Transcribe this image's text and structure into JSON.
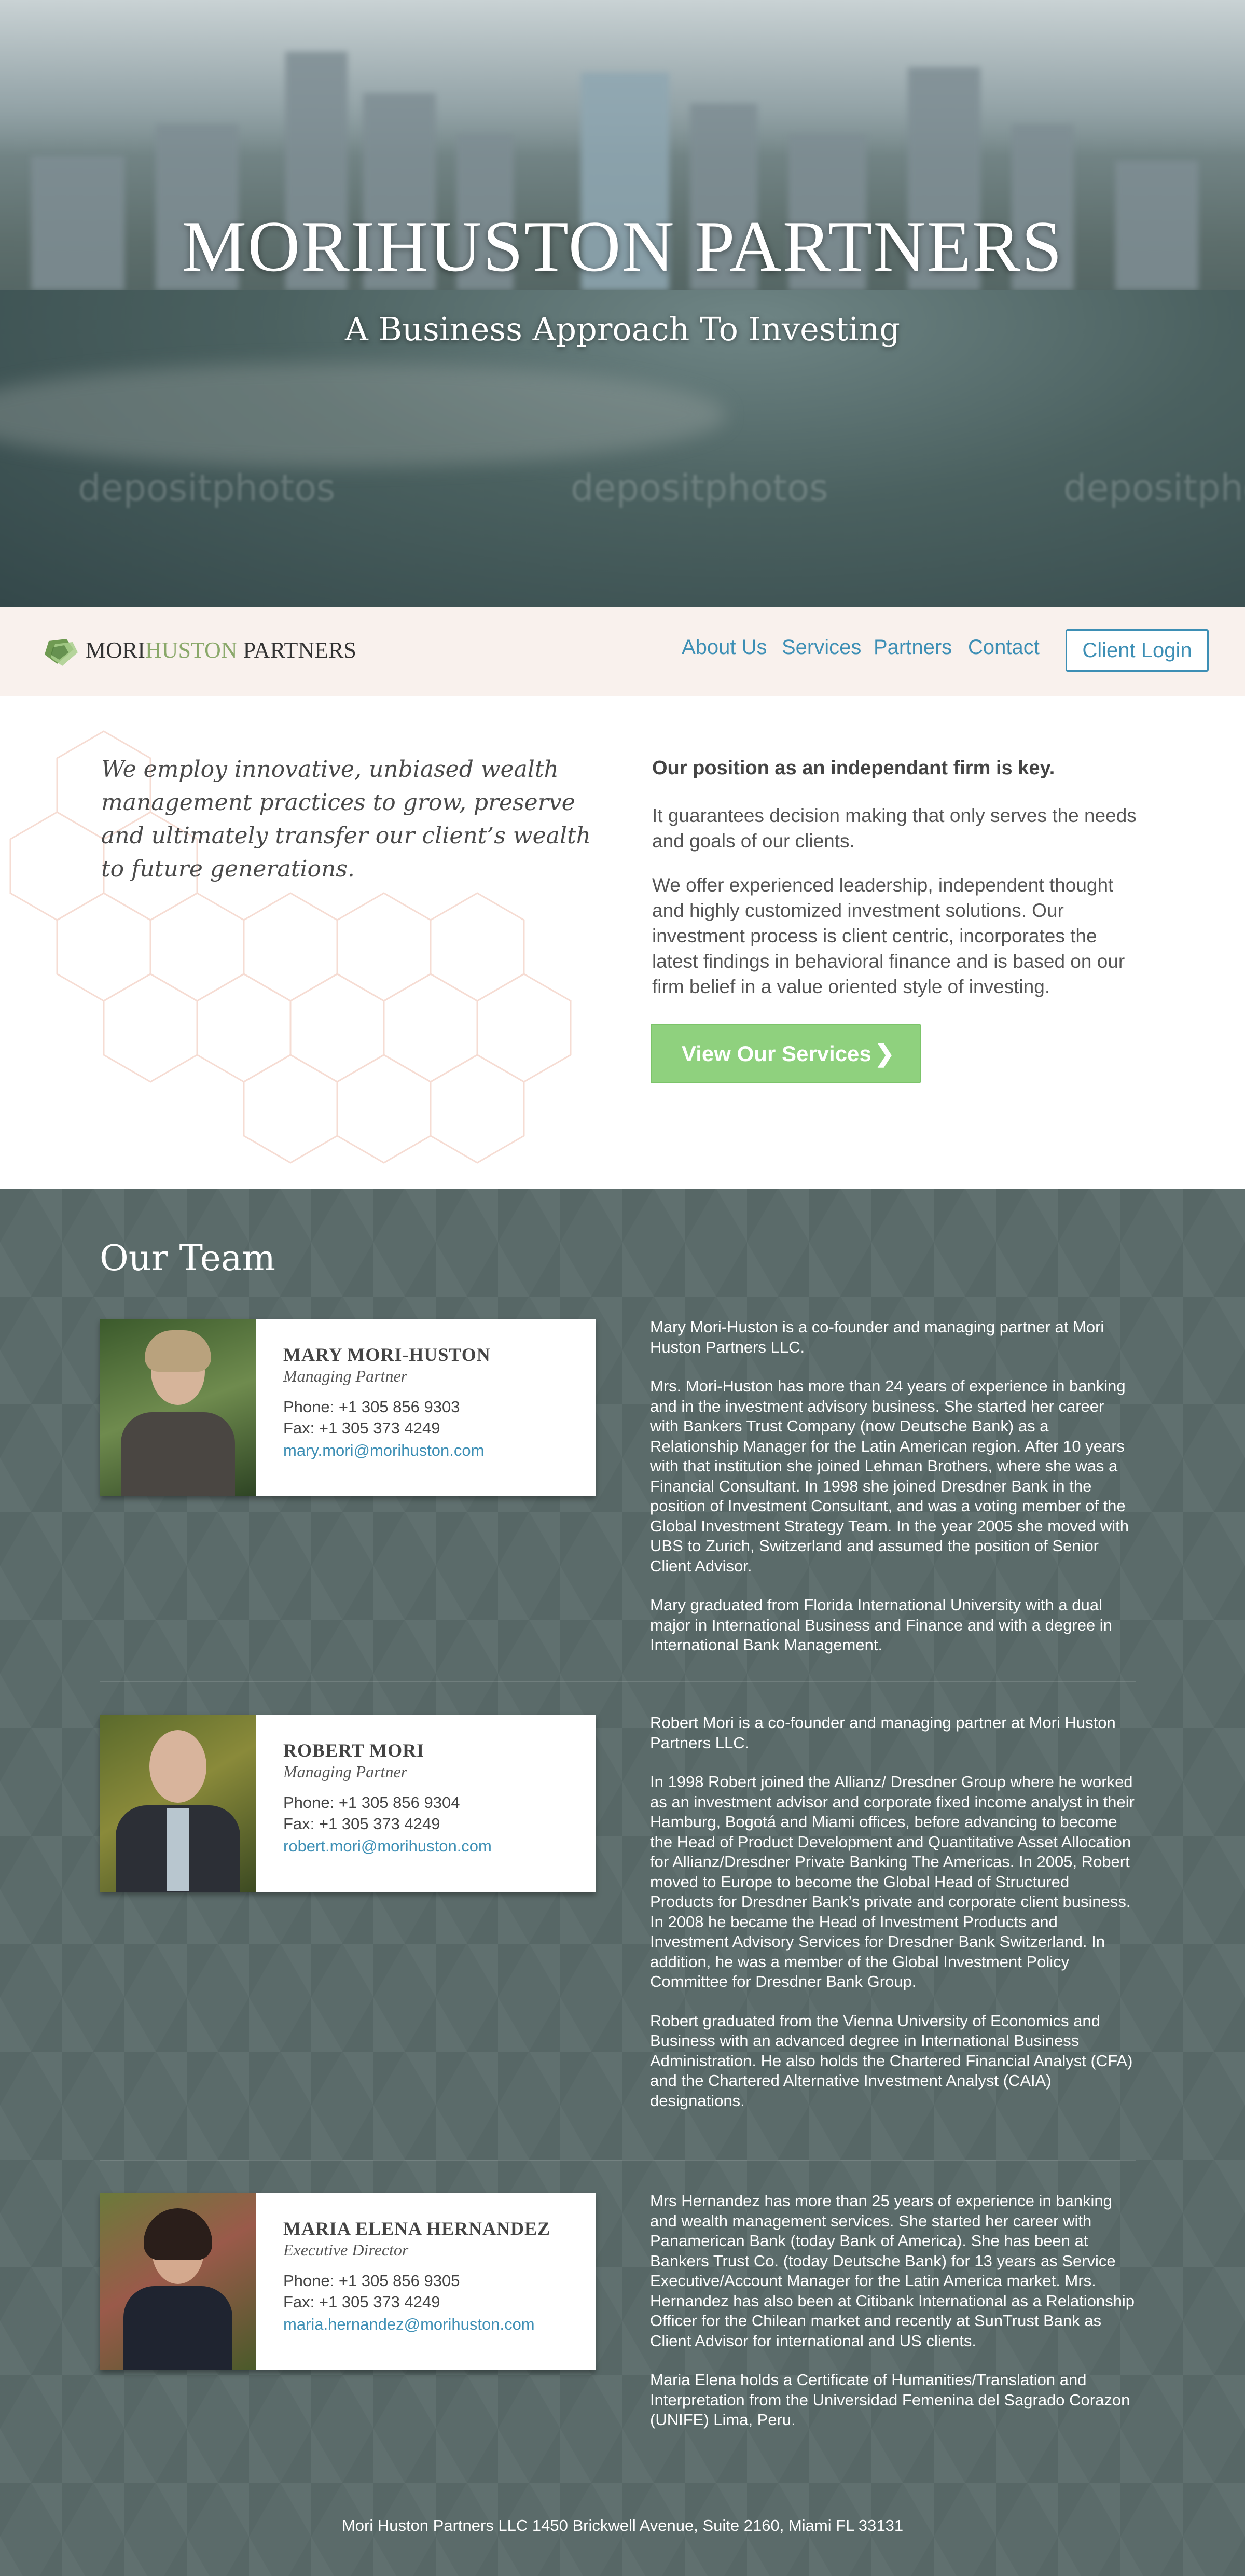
{
  "hero": {
    "title": "MORIHUSTON PARTNERS",
    "subtitle": "A Business Approach To Investing",
    "watermark": "depositphotos"
  },
  "nav": {
    "logo_part1": "MORI",
    "logo_part2": "HUSTON",
    "logo_part3": "PARTNERS",
    "links": [
      "About Us",
      "Services",
      "Partners",
      "Contact"
    ],
    "client_login": "Client Login"
  },
  "intro": {
    "quote": "We employ innovative, unbiased wealth management practices  to grow, preserve and ultimately transfer our client’s wealth to future generations.",
    "heading": "Our position as an independant firm is key.",
    "p1": "It guarantees decision making that only serves the needs and goals of our clients.",
    "p2": "We offer experienced leadership, independent thought and highly customized investment solutions. Our investment process is client centric, incorporates the latest findings in behavioral finance and is based on our firm belief in a value oriented style of investing.",
    "button": "View Our Services",
    "button_icon": "chevron-right-icon"
  },
  "team": {
    "title": "Our Team",
    "members": [
      {
        "name": "MARY MORI-HUSTON",
        "role": "Managing Partner",
        "phone": "Phone: +1 305 856 9303",
        "fax": "Fax: +1 305 373 4249",
        "email": "mary.mori@morihuston.com",
        "bio": [
          "Mary Mori-Huston is a co-founder and managing partner at Mori Huston Partners LLC.",
          "Mrs. Mori-Huston has more than 24 years of experience in banking and in the investment advisory business. She started her career with Bankers Trust Company (now Deutsche Bank) as a Relationship Manager for the Latin American region. After 10 years with that institution she joined Lehman Brothers, where she was a Financial Consultant. In 1998 she joined Dresdner Bank in the position of Investment Consultant, and was a voting member of the Global Investment Strategy Team. In the year 2005 she moved with UBS to Zurich, Switzerland and assumed the position of Senior Client Advisor.",
          "Mary graduated from Florida International University with a dual major in International Business and Finance and with a degree in International Bank Management."
        ]
      },
      {
        "name": "ROBERT MORI",
        "role": "Managing Partner",
        "phone": "Phone: +1 305 856 9304",
        "fax": "Fax: +1 305 373 4249",
        "email": "robert.mori@morihuston.com",
        "bio": [
          "Robert Mori is a co-founder and managing partner at Mori Huston Partners LLC.",
          "In 1998 Robert  joined the Allianz/ Dresdner Group where he worked as an investment advisor and corporate fixed income analyst in their Hamburg, Bogotá and Miami offices, before advancing to become the Head of Product Development and Quantitative Asset Allocation for Allianz/Dresdner Private Banking The Americas. In 2005, Robert moved to Europe to become the Global Head of Structured Products for Dresdner Bank’s private and corporate client business. In 2008 he became the Head of Investment Products and Investment Advisory Services for Dresdner Bank Switzerland. In addition, he was a member of the Global Investment Policy Committee for Dresdner Bank Group.",
          "Robert graduated from the Vienna University of Economics and Business with an advanced degree in International Business Administration. He also holds the Chartered Financial Analyst (CFA) and the Chartered Alternative Investment Analyst (CAIA) designations."
        ]
      },
      {
        "name": "MARIA ELENA HERNANDEZ",
        "role": "Executive Director",
        "phone": "Phone: +1 305 856 9305",
        "fax": "Fax: +1 305 373 4249",
        "email": "maria.hernandez@morihuston.com",
        "bio": [
          "Mrs Hernandez has more than 25 years of experience in banking and wealth management services. She started her career with Panamerican Bank (today Bank of America). She has been at Bankers Trust Co. (today Deutsche Bank) for 13 years as Service Executive/Account Manager for the Latin America market.  Mrs. Hernandez has also been at Citibank International as a Relationship Officer for the Chilean market and recently at SunTrust Bank as Client Advisor for international and US clients.",
          "Maria Elena holds a Certificate of Humanities/Translation and Interpretation from the Universidad Femenina del Sagrado Corazon (UNIFE) Lima, Peru."
        ]
      }
    ]
  },
  "footer": {
    "address": "Mori Huston Partners LLC  1450 Brickwell Avenue, Suite 2160, Miami FL 33131"
  }
}
